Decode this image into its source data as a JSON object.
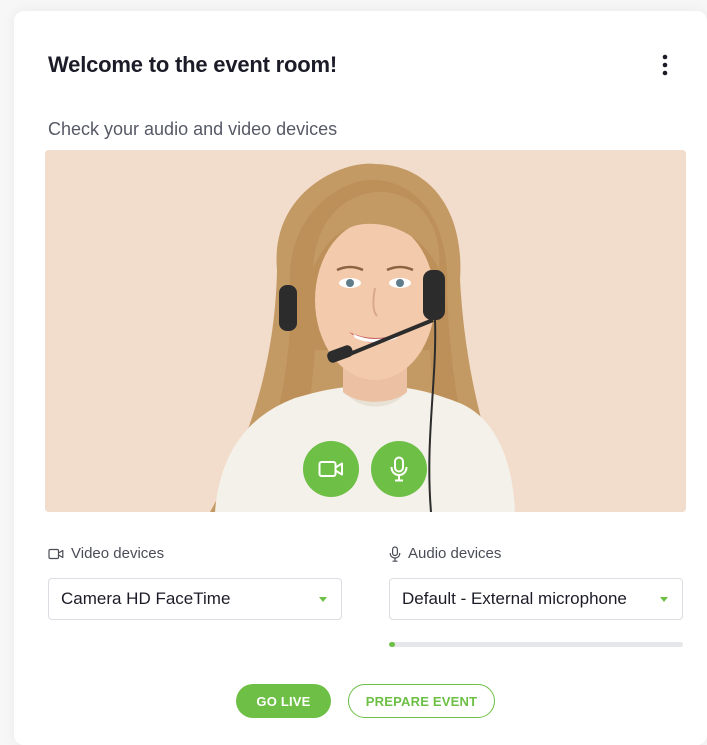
{
  "colors": {
    "accent": "#6dbf45",
    "title_text": "#1c1c28",
    "muted_text": "#565966",
    "video_background": "#f2dccb"
  },
  "header": {
    "title": "Welcome to the event room!",
    "menu_icon": "more-vertical-icon"
  },
  "subtitle": "Check your audio and video devices",
  "preview": {
    "camera_button_icon": "video-camera-icon",
    "mic_button_icon": "microphone-icon"
  },
  "video_devices": {
    "label": "Video devices",
    "icon": "video-camera-icon",
    "selected": "Camera HD FaceTime"
  },
  "audio_devices": {
    "label": "Audio devices",
    "icon": "microphone-icon",
    "selected": "Default - External microphone",
    "input_level_fraction": 0.02
  },
  "actions": {
    "go_live_label": "GO LIVE",
    "prepare_event_label": "PREPARE EVENT"
  }
}
